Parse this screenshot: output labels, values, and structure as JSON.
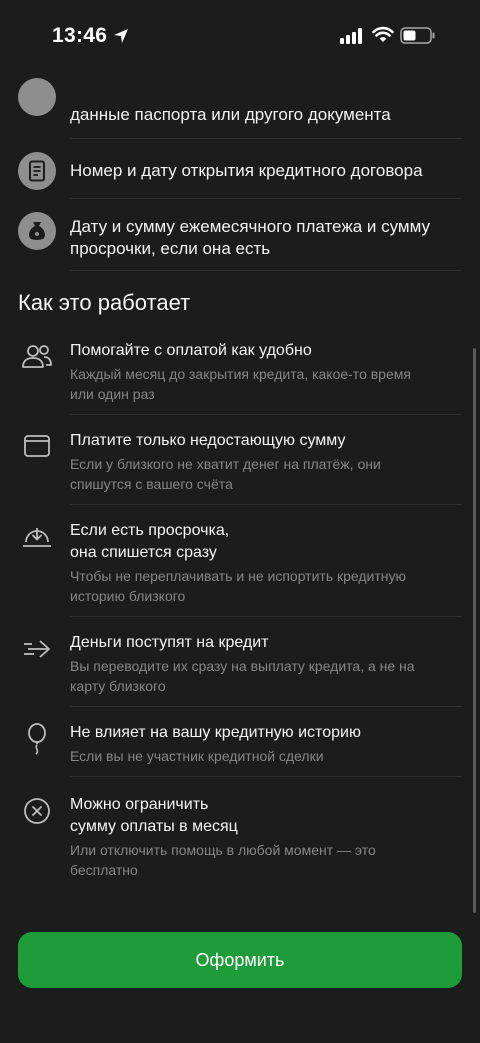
{
  "status_bar": {
    "time": "13:46"
  },
  "documents": [
    {
      "text_line1": "данные паспорта или другого документа",
      "icon": "person-icon"
    },
    {
      "text_line1": "Номер и дату открытия кредитного договора",
      "icon": "document-icon"
    },
    {
      "text_line1": "Дату и сумму ежемесячного платежа и сумму",
      "text_line2": "просрочки, если она есть",
      "icon": "money-bag-icon"
    }
  ],
  "section": {
    "title": "Как это работает"
  },
  "features": [
    {
      "title": "Помогайте с оплатой как удобно",
      "sub1": "Каждый месяц до закрытия кредита, какое-то время",
      "sub2": "или один раз",
      "icon": "people-icon"
    },
    {
      "title": "Платите только недостающую сумму",
      "sub1": "Если у близкого не хватит денег на платёж, они",
      "sub2": "спишутся с вашего счёта",
      "icon": "wallet-icon"
    },
    {
      "title": "Если есть просрочка,",
      "title2": "она спишется сразу",
      "sub1": "Чтобы не переплачивать и не испортить кредитную",
      "sub2": "историю близкого",
      "icon": "download-icon"
    },
    {
      "title": "Деньги поступят на кредит",
      "sub1": "Вы переводите их сразу на выплату кредита, а не на",
      "sub2": "карту близкого",
      "icon": "transfer-arrow-icon"
    },
    {
      "title": "Не влияет на вашу кредитную историю",
      "sub1": "Если вы не участник кредитной сделки",
      "icon": "balloon-icon"
    },
    {
      "title": "Можно ограничить",
      "title2": "сумму оплаты в месяц",
      "sub1": "Или отключить помощь в любой момент — это",
      "sub2": "бесплатно",
      "icon": "close-circle-icon"
    }
  ],
  "cta": {
    "label": "Оформить"
  },
  "colors": {
    "background": "#1c1c1c",
    "accent": "#1f9c3a",
    "secondary_text": "#868686"
  }
}
